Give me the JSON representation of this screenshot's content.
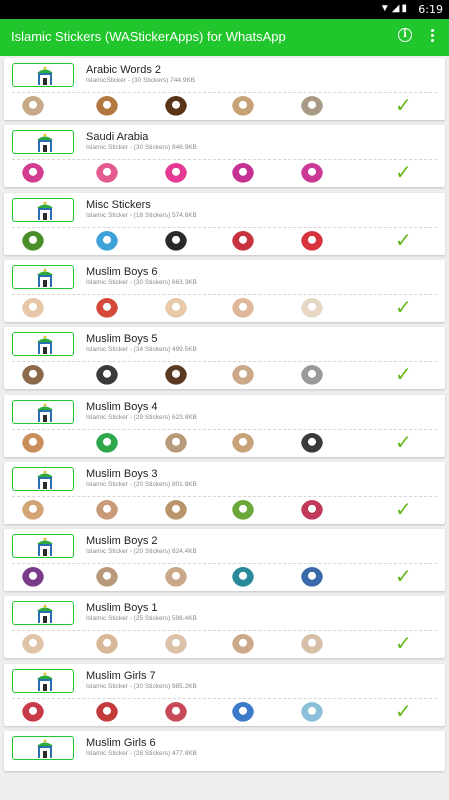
{
  "status_bar": {
    "time": "6:19"
  },
  "app_bar": {
    "title": "Islamic Stickers (WAStickerApps) for WhatsApp",
    "info_icon": "info-circle-icon",
    "menu_icon": "more-vert-icon"
  },
  "colors": {
    "accent": "#21c52c",
    "check": "#66b81a"
  },
  "packs": [
    {
      "name": "Arabic Words 2",
      "meta": "IslamicSticker - (30 Stickers) 744.9KB",
      "sticker_colors": [
        "#c6a987",
        "#b2783f",
        "#5a3417",
        "#c8a277",
        "#a89a86"
      ],
      "added": true
    },
    {
      "name": "Saudi Arabia",
      "meta": "Islamic Sticker - (30 Stickers) 846.9KB",
      "sticker_colors": [
        "#d23d90",
        "#e45b92",
        "#e43a93",
        "#c53092",
        "#c83a95"
      ],
      "added": true
    },
    {
      "name": "Misc Stickers",
      "meta": "Islamic Sticker - (18 Stickers) 574.6KB",
      "sticker_colors": [
        "#4b8f2a",
        "#3ea2d8",
        "#2a2a2a",
        "#c8323e",
        "#d8323e"
      ],
      "added": true
    },
    {
      "name": "Muslim Boys 6",
      "meta": "Islamic Sticker - (30 Stickers) 663.3KB",
      "sticker_colors": [
        "#e6c7a8",
        "#d44a3a",
        "#e8c9a8",
        "#e0b79a",
        "#e8d6c6"
      ],
      "added": true
    },
    {
      "name": "Muslim Boys 5",
      "meta": "Islamic Sticker - (34 Stickers) 499.5KB",
      "sticker_colors": [
        "#8a6a4a",
        "#3a3a3a",
        "#5a3a22",
        "#caa888",
        "#9a9a9a"
      ],
      "added": true
    },
    {
      "name": "Muslim Boys 4",
      "meta": "Islamic Sticker - (29 Stickers) 623.8KB",
      "sticker_colors": [
        "#c88f5a",
        "#2ea84a",
        "#b89a7a",
        "#caa27a",
        "#3a3a3a"
      ],
      "added": true
    },
    {
      "name": "Muslim Boys 3",
      "meta": "Islamic Sticker - (20 Stickers) 801.8KB",
      "sticker_colors": [
        "#d4a574",
        "#c89a7a",
        "#b8956a",
        "#6aa83a",
        "#c23a5a"
      ],
      "added": true
    },
    {
      "name": "Muslim Boys 2",
      "meta": "Islamic Sticker - (20 Stickers) 824.4KB",
      "sticker_colors": [
        "#7a3a8a",
        "#b89a7a",
        "#c8a888",
        "#2a8a9a",
        "#3a6aaa"
      ],
      "added": true
    },
    {
      "name": "Muslim Boys 1",
      "meta": "Islamic Sticker - (25 Stickers) 598.4KB",
      "sticker_colors": [
        "#e0c4a8",
        "#d8b898",
        "#dcc2a8",
        "#caa888",
        "#d8c0a8"
      ],
      "added": true
    },
    {
      "name": "Muslim Girls 7",
      "meta": "Islamic Sticker - (30 Stickers) 985.2KB",
      "sticker_colors": [
        "#c83a4a",
        "#c23a3a",
        "#c84a5a",
        "#3a7ac8",
        "#8ac0d8"
      ],
      "added": true
    },
    {
      "name": "Muslim Girls 6",
      "meta": "Islamic Sticker - (28 Stickers) 477.8KB",
      "sticker_colors": [],
      "added": false
    }
  ]
}
